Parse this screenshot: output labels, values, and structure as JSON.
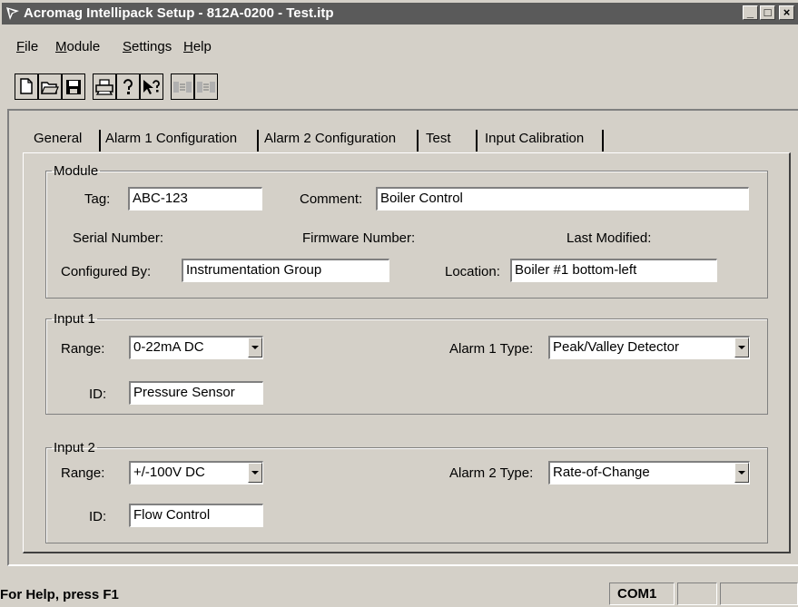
{
  "window": {
    "title": "Acromag Intellipack Setup - 812A-0200 - Test.itp",
    "minimize": "_",
    "maximize": "□",
    "close": "×"
  },
  "menu": [
    {
      "label": "File",
      "mnemonic": "F"
    },
    {
      "label": "Module",
      "mnemonic": "M"
    },
    {
      "label": "Settings",
      "mnemonic": "S"
    },
    {
      "label": "Help",
      "mnemonic": "H"
    }
  ],
  "toolbar": {
    "icons": [
      "new-file-icon",
      "open-folder-icon",
      "save-disk-icon",
      "print-icon",
      "help-icon",
      "context-help-icon",
      "download-icon",
      "upload-icon"
    ]
  },
  "tabs": [
    "General",
    "Alarm 1 Configuration",
    "Alarm 2 Configuration",
    "Test",
    "Input Calibration"
  ],
  "module": {
    "legend": "Module",
    "tag_label": "Tag:",
    "tag_value": "ABC-123",
    "comment_label": "Comment:",
    "comment_value": "Boiler Control",
    "serial_label": "Serial Number:",
    "firmware_label": "Firmware Number:",
    "modified_label": "Last Modified:",
    "configured_label": "Configured By:",
    "configured_value": "Instrumentation Group",
    "location_label": "Location:",
    "location_value": "Boiler #1 bottom-left"
  },
  "input1": {
    "legend": "Input 1",
    "range_label": "Range:",
    "range_value": "0-22mA DC",
    "alarm_label": "Alarm 1 Type:",
    "alarm_value": "Peak/Valley Detector",
    "id_label": "ID:",
    "id_value": "Pressure Sensor"
  },
  "input2": {
    "legend": "Input 2",
    "range_label": "Range:",
    "range_value": "+/-100V DC",
    "alarm_label": "Alarm 2 Type:",
    "alarm_value": "Rate-of-Change",
    "id_label": "ID:",
    "id_value": "Flow Control"
  },
  "status": {
    "help_text": "For Help, press F1",
    "port": "COM1"
  },
  "colors": {
    "titlebar": "#5a5a5a",
    "face": "#d4d0c8"
  }
}
